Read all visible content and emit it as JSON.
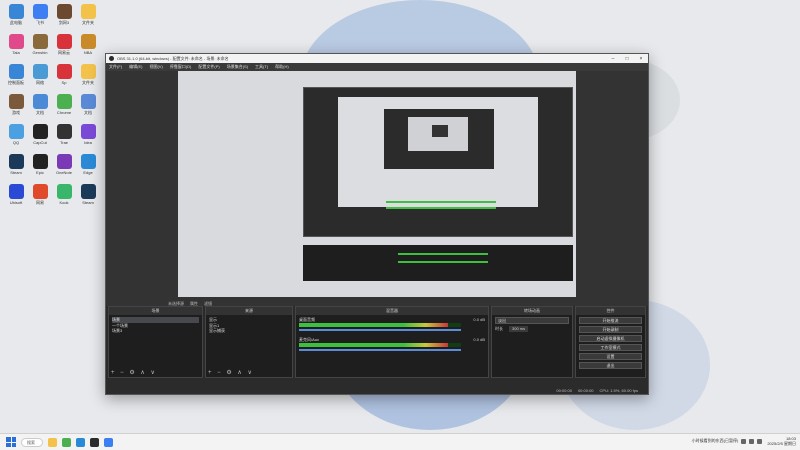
{
  "desktop": {
    "icons": [
      {
        "label": "此电脑",
        "color": "#3a86d6"
      },
      {
        "label": "飞书",
        "color": "#3d7ff2"
      },
      {
        "label": "剑网3",
        "color": "#6b4a2f"
      },
      {
        "label": "文件夹",
        "color": "#f2c24a"
      },
      {
        "label": "Tala",
        "color": "#e04a8a"
      },
      {
        "label": "Genshin",
        "color": "#8a6a3a"
      },
      {
        "label": "网易云",
        "color": "#d8333b"
      },
      {
        "label": "NBA",
        "color": "#c98a2a"
      },
      {
        "label": "控制面板",
        "color": "#3a86d6"
      },
      {
        "label": "网络",
        "color": "#4a9ad6"
      },
      {
        "label": "Sp",
        "color": "#d8333b"
      },
      {
        "label": "文件夹",
        "color": "#f2c24a"
      },
      {
        "label": "游戏",
        "color": "#7a5a3a"
      },
      {
        "label": "文档",
        "color": "#4a8ad6"
      },
      {
        "label": "Chrome",
        "color": "#4caf50"
      },
      {
        "label": "文档",
        "color": "#5a8ad6"
      },
      {
        "label": "QQ",
        "color": "#4aa0e0"
      },
      {
        "label": "CapCut",
        "color": "#222222"
      },
      {
        "label": "Trae",
        "color": "#333333"
      },
      {
        "label": "Idea",
        "color": "#7a4ad6"
      },
      {
        "label": "Steam",
        "color": "#1b3a5a"
      },
      {
        "label": "Epic",
        "color": "#222222"
      },
      {
        "label": "OneNote",
        "color": "#7a3ab6"
      },
      {
        "label": "Edge",
        "color": "#2a8ad6"
      },
      {
        "label": "Ubisoft",
        "color": "#2a4ad6"
      },
      {
        "label": "网易",
        "color": "#e04a2a"
      },
      {
        "label": "Kook",
        "color": "#3ab66a"
      },
      {
        "label": "Steam",
        "color": "#1b3a5a"
      }
    ]
  },
  "obs": {
    "window_title": "OBS 31.1.0 (64-bit, windows) - 配置文件: 未命名 - 场景: 未命名",
    "menu": [
      "文件(F)",
      "编辑(E)",
      "视图(V)",
      "停靠窗口(D)",
      "配置文件(P)",
      "场景集合(S)",
      "工具(T)",
      "帮助(H)"
    ],
    "preview_bar": [
      "未选择源",
      "属性",
      "滤镜"
    ],
    "scenes": {
      "title": "场景",
      "items": [
        "场景",
        "一个场景",
        "场景3"
      ]
    },
    "sources": {
      "title": "来源",
      "items": [
        "显示",
        "显示1",
        "显示捕获"
      ]
    },
    "audio": {
      "title": "混音器",
      "channels": [
        {
          "name": "桌面音频",
          "level": "0.0 dB",
          "fill_pct": 92
        },
        {
          "name": "麦克风/Aux",
          "level": "0.0 dB",
          "fill_pct": 92
        }
      ]
    },
    "transitions": {
      "title": "转场动画",
      "type": "淡出",
      "duration_label": "时长",
      "duration": "300 ms"
    },
    "controls": {
      "title": "控件",
      "buttons": [
        "开始推流",
        "开始录制",
        "启动虚拟摄像机",
        "工作室模式",
        "设置",
        "退出"
      ]
    },
    "status": {
      "rec": "00:00:00",
      "stream": "00:00:00",
      "cpu": "CPU: 1.5%, 60.00 fps"
    }
  },
  "taskbar": {
    "search_placeholder": "搜索",
    "tray_text": "小时候看到的东西(已暂停)",
    "time": "18:03",
    "date": "2025/2/5 星期日"
  }
}
